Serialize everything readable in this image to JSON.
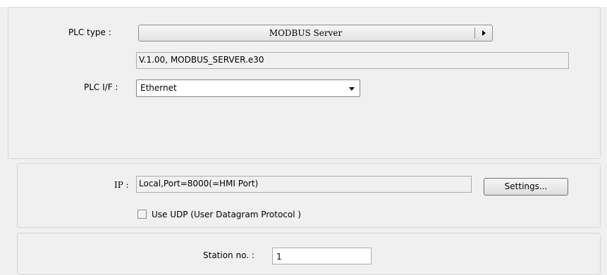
{
  "plc": {
    "type_label": "PLC type :",
    "type_value": "MODBUS Server",
    "version": "V.1.00, MODBUS_SERVER.e30",
    "if_label": "PLC I/F :",
    "if_value": "Ethernet"
  },
  "network": {
    "ip_label": "IP :",
    "ip_value": "Local,Port=8000(=HMI Port)",
    "settings_label": "Settings...",
    "udp_label": "Use UDP (User Datagram Protocol )",
    "udp_checked": false
  },
  "station": {
    "label": "Station no. :",
    "value": "1"
  },
  "icons": {
    "plc_type_arrow": "triangle-right-icon",
    "plc_if_arrow": "chevron-down-icon"
  }
}
